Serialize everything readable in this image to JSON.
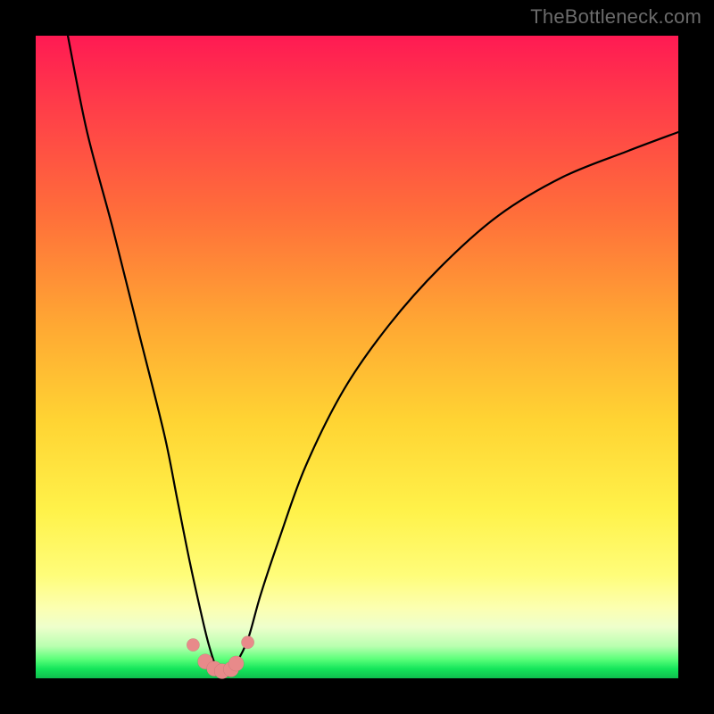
{
  "watermark": "TheBottleneck.com",
  "colors": {
    "frame": "#000000",
    "gradient_top": "#ff1a53",
    "gradient_bottom": "#0fbf4e",
    "curve": "#000000",
    "dots": "#e88a8a"
  },
  "chart_data": {
    "type": "line",
    "title": "",
    "xlabel": "",
    "ylabel": "",
    "xlim": [
      0,
      100
    ],
    "ylim": [
      0,
      100
    ],
    "grid": false,
    "legend": false,
    "axes_visible": false,
    "series": [
      {
        "name": "curve",
        "x": [
          5,
          8,
          12,
          16,
          20,
          22,
          24,
          26,
          27,
          28,
          29,
          30,
          31,
          33,
          35,
          38,
          42,
          48,
          55,
          63,
          72,
          82,
          92,
          100
        ],
        "y": [
          100,
          85,
          70,
          54,
          38,
          28,
          18,
          9,
          5,
          2,
          1,
          1,
          2,
          6,
          13,
          22,
          33,
          45,
          55,
          64,
          72,
          78,
          82,
          85
        ]
      }
    ],
    "dots": {
      "name": "datapoints",
      "x": [
        24.5,
        26.4,
        27.8,
        29.0,
        30.4,
        31.2,
        33.0
      ],
      "y": [
        5.2,
        2.6,
        1.5,
        1.1,
        1.4,
        2.3,
        5.6
      ]
    },
    "minimum": {
      "x": 29.5,
      "y": 1
    },
    "background": "vertical-rainbow-gradient red→yellow→green"
  }
}
